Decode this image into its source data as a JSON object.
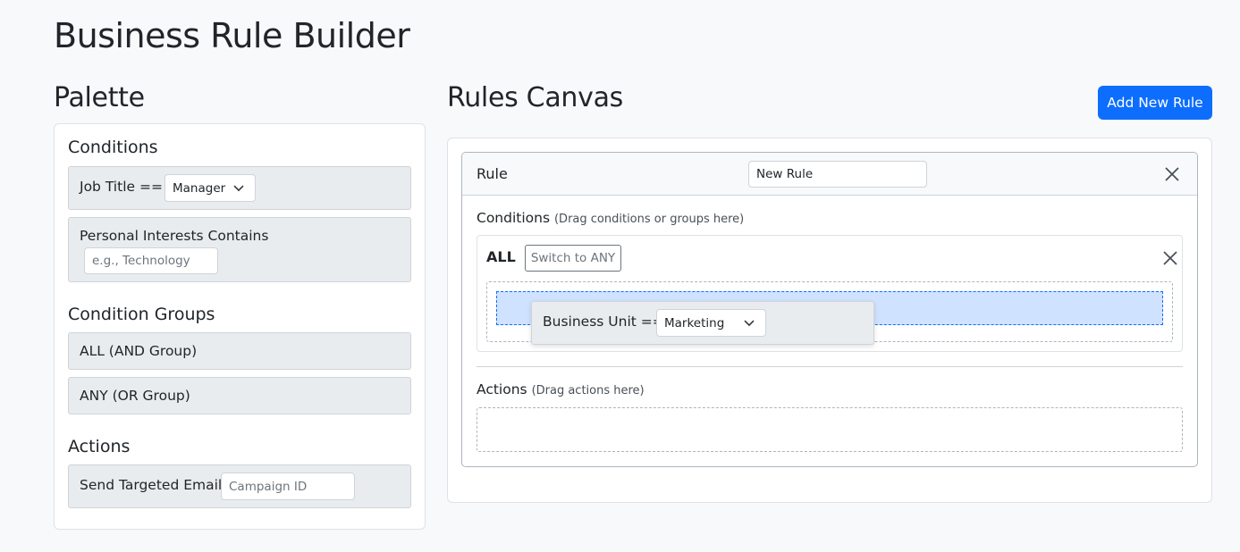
{
  "page": {
    "title": "Business Rule Builder"
  },
  "palette": {
    "title": "Palette",
    "conditions_heading": "Conditions",
    "job_title": {
      "label": "Job Title ==",
      "select_value": "Manager"
    },
    "personal_interests": {
      "label": "Personal Interests Contains",
      "placeholder": "e.g., Technology"
    },
    "groups_heading": "Condition Groups",
    "all_group": "ALL (AND Group)",
    "any_group": "ANY (OR Group)",
    "actions_heading": "Actions",
    "send_email": {
      "label": "Send Targeted Email",
      "placeholder": "Campaign ID"
    }
  },
  "canvas": {
    "title": "Rules Canvas",
    "add_rule_label": "Add New Rule",
    "rule": {
      "label": "Rule",
      "name_value": "New Rule",
      "conditions_heading": "Conditions",
      "conditions_hint": "(Drag conditions or groups here)",
      "group": {
        "operator": "ALL",
        "switch_label": "Switch to ANY"
      },
      "dragging": {
        "label": "Business Unit ==",
        "select_value": "Marketing"
      },
      "actions_heading": "Actions",
      "actions_hint": "(Drag actions here)"
    }
  },
  "colors": {
    "primary": "#0d6efd",
    "drop_highlight": "#cfe2ff",
    "item_bg": "#e9ecef"
  },
  "icons": {
    "close": "close-icon",
    "chevron": "chevron-down-icon"
  }
}
